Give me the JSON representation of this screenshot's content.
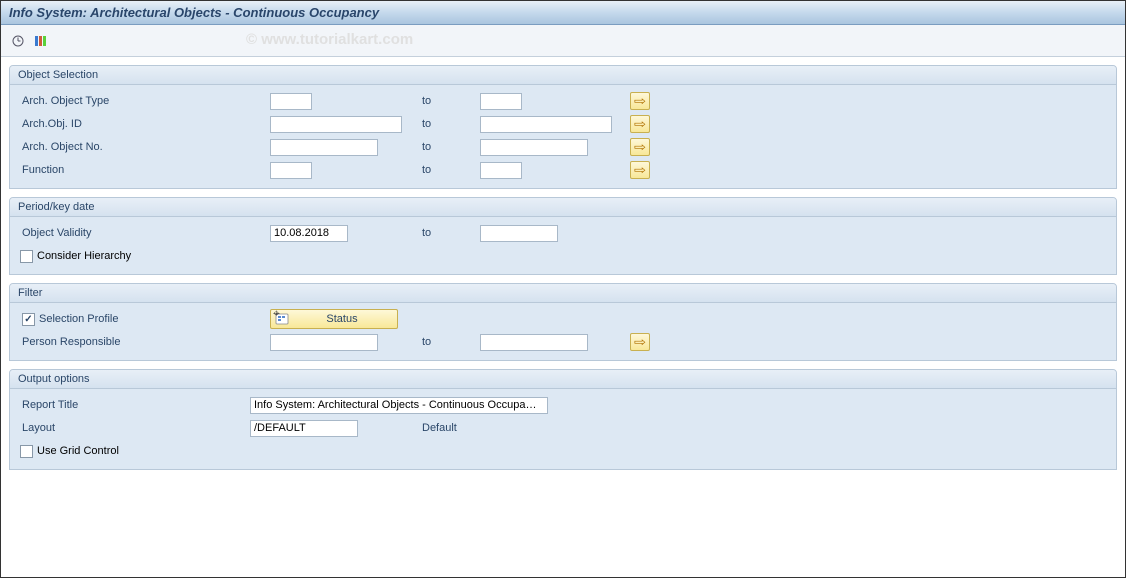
{
  "title": "Info System: Architectural Objects - Continuous Occupancy",
  "watermark": "© www.tutorialkart.com",
  "groups": {
    "object_selection": {
      "header": "Object Selection",
      "arch_object_type": {
        "label": "Arch. Object Type",
        "from": "",
        "to_label": "to",
        "to": ""
      },
      "arch_obj_id": {
        "label": "Arch.Obj. ID",
        "from": "",
        "to_label": "to",
        "to": ""
      },
      "arch_object_no": {
        "label": "Arch. Object No.",
        "from": "",
        "to_label": "to",
        "to": ""
      },
      "function": {
        "label": "Function",
        "from": "",
        "to_label": "to",
        "to": ""
      }
    },
    "period": {
      "header": "Period/key date",
      "object_validity": {
        "label": "Object Validity",
        "from": "10.08.2018",
        "to_label": "to",
        "to": ""
      },
      "consider_hierarchy": {
        "label": "Consider Hierarchy",
        "checked": false
      }
    },
    "filter": {
      "header": "Filter",
      "selection_profile": {
        "label": "Selection Profile",
        "checked": true,
        "button_label": "Status"
      },
      "person_responsible": {
        "label": "Person Responsible",
        "from": "",
        "to_label": "to",
        "to": ""
      }
    },
    "output": {
      "header": "Output options",
      "report_title": {
        "label": "Report Title",
        "value": "Info System: Architectural Objects - Continuous Occupa…"
      },
      "layout": {
        "label": "Layout",
        "value": "/DEFAULT",
        "description": "Default"
      },
      "use_grid": {
        "label": "Use Grid Control",
        "checked": false
      }
    }
  }
}
